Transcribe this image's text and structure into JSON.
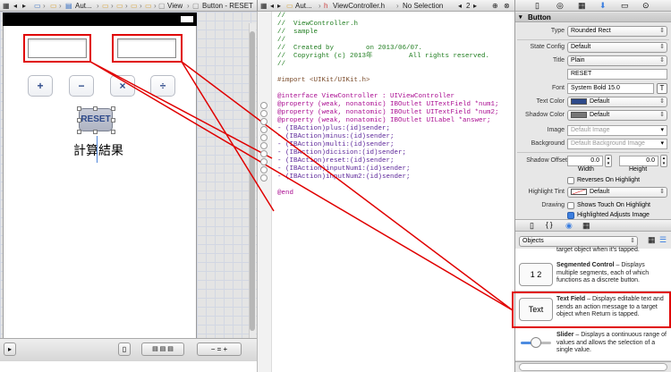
{
  "jumpbar_left": {
    "crumb_aut": "Aut...",
    "crumb_view": "View",
    "crumb_button": "Button - RESET"
  },
  "jumpbar_editor": {
    "file": "ViewController.h",
    "selection": "No Selection",
    "page": "2"
  },
  "canvas": {
    "buttons": [
      "+",
      "−",
      "×",
      "÷"
    ],
    "reset_label": "RESET",
    "result_label": "計算結果"
  },
  "code_lines": [
    {
      "cls": "c-comment",
      "text": "//"
    },
    {
      "cls": "c-comment",
      "text": "//  ViewController.h"
    },
    {
      "cls": "c-comment",
      "text": "//  sample"
    },
    {
      "cls": "c-comment",
      "text": "//"
    },
    {
      "cls": "c-comment",
      "text": "//  Created by        on 2013/06/07."
    },
    {
      "cls": "c-comment",
      "text": "//  Copyright (c) 2013年         All rights reserved."
    },
    {
      "cls": "c-comment",
      "text": "//"
    },
    {
      "cls": "c-plain",
      "text": ""
    },
    {
      "cls": "c-pre",
      "text": "#import <UIKit/UIKit.h>"
    },
    {
      "cls": "c-plain",
      "text": ""
    },
    {
      "cls": "c-kw",
      "text": "@interface ViewController : UIViewController"
    },
    {
      "cls": "c-kw",
      "text": "@property (weak, nonatomic) IBOutlet UITextField *num1;"
    },
    {
      "cls": "c-kw",
      "text": "@property (weak, nonatomic) IBOutlet UITextField *num2;"
    },
    {
      "cls": "c-kw",
      "text": "@property (weak, nonatomic) IBOutlet UILabel *answer;"
    },
    {
      "cls": "c-type",
      "text": "- (IBAction)plus:(id)sender;"
    },
    {
      "cls": "c-type",
      "text": "- (IBAction)minus:(id)sender;"
    },
    {
      "cls": "c-type",
      "text": "- (IBAction)multi:(id)sender;"
    },
    {
      "cls": "c-type",
      "text": "- (IBAction)dicision:(id)sender;"
    },
    {
      "cls": "c-type",
      "text": "- (IBAction)reset:(id)sender;"
    },
    {
      "cls": "c-type",
      "text": "- (IBAction)inputNum1:(id)sender;"
    },
    {
      "cls": "c-type",
      "text": "- (IBAction)inputNum2:(id)sender;"
    },
    {
      "cls": "c-plain",
      "text": ""
    },
    {
      "cls": "c-kw",
      "text": "@end"
    }
  ],
  "inspector": {
    "section_button": "Button",
    "type_label": "Type",
    "type_value": "Rounded Rect",
    "state_label": "State Config",
    "state_value": "Default",
    "title_label": "Title",
    "title_value": "Plain",
    "title_text": "RESET",
    "font_label": "Font",
    "font_value": "System Bold 15.0",
    "text_color_label": "Text Color",
    "text_color_value": "Default",
    "shadow_color_label": "Shadow Color",
    "shadow_color_value": "Default",
    "image_label": "Image",
    "image_placeholder": "Default Image",
    "background_label": "Background",
    "background_placeholder": "Default Background Image",
    "shadow_offset_label": "Shadow Offset",
    "shadow_w": "0.0",
    "shadow_h": "0.0",
    "width_label": "Width",
    "height_label": "Height",
    "reverses_label": "Reverses On Highlight",
    "highlight_tint_label": "Highlight Tint",
    "highlight_tint_value": "Default",
    "drawing_label": "Drawing",
    "shows_touch_label": "Shows Touch On Highlight",
    "adjusts_label": "Highlighted Adjusts Image"
  },
  "library": {
    "filter_value": "Objects",
    "cut_text": "target object when it's tapped.",
    "items": [
      {
        "icon": "1 2",
        "title": "Segmented Control",
        "desc": " – Displays multiple segments, each of which functions as a discrete button."
      },
      {
        "icon": "Text",
        "title": "Text Field",
        "desc": " – Displays editable text and sends an action message to a target object when Return is tapped."
      },
      {
        "icon": "",
        "title": "Slider",
        "desc": " – Displays a continuous range of values and allows the selection of a single value."
      }
    ]
  },
  "colors": {
    "annotation": "#e00000",
    "accent": "#3c7fe0"
  }
}
